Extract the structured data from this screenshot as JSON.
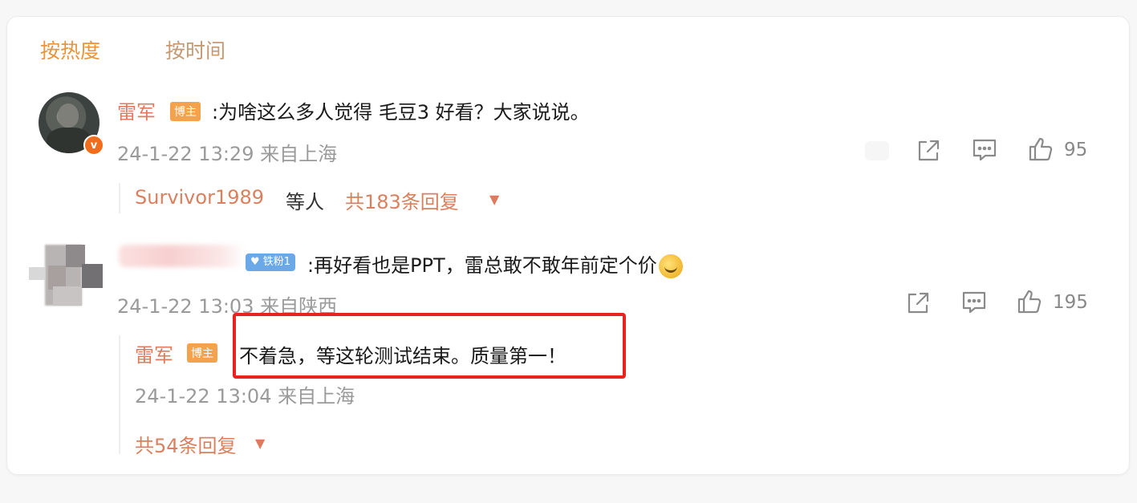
{
  "sort_tabs": {
    "hot": "按热度",
    "time": "按时间"
  },
  "comment1": {
    "username": "雷军",
    "role_badge": "博主",
    "verified_badge": "v",
    "text": ":为啥这么多人觉得 毛豆3 好看？大家说说。",
    "timestamp": "24-1-22 13:29 来自上海",
    "likes": "95",
    "replies": {
      "user": "Survivor1989",
      "suffix": "等人",
      "count_label": "共183条回复"
    }
  },
  "comment2": {
    "fan_badge": "铁粉1",
    "text": ":再好看也是PPT，雷总敢不敢年前定个价",
    "timestamp": "24-1-22 13:03 来自陕西",
    "likes": "195",
    "reply": {
      "username": "雷军",
      "role_badge": "博主",
      "text": "不着急，等这轮测试结束。质量第一！",
      "timestamp": "24-1-22 13:04 来自上海"
    },
    "replies_count_label": "共54条回复"
  },
  "icons": {
    "share": "share-icon",
    "comment": "comment-icon",
    "like": "thumbs-up-icon",
    "dropdown": "caret-down-icon"
  },
  "colors": {
    "accent_orange": "#e8943d",
    "username": "#e07a5f",
    "badge_orange": "#f4a24c",
    "fan_badge_blue": "#6aa8e8",
    "highlight_red": "#e8231f"
  }
}
